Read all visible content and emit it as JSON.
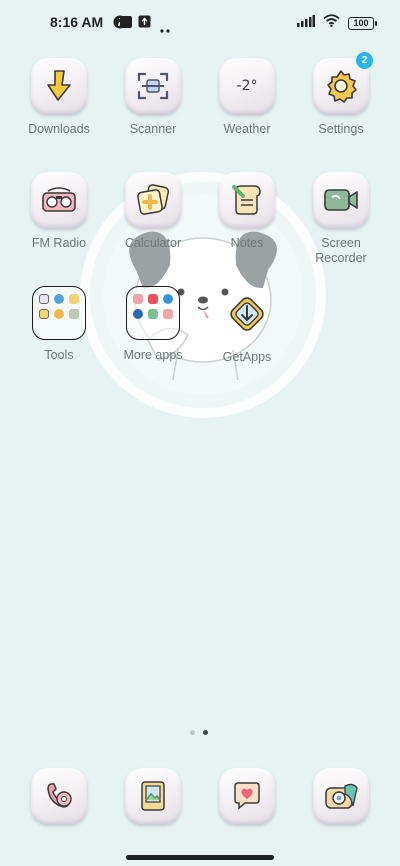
{
  "status_bar": {
    "time": "8:16 AM",
    "battery": "100",
    "icons": [
      "pinterest-icon",
      "square-notification-icon",
      "upload-icon",
      "more-dots-icon",
      "signal-icon",
      "wifi-icon",
      "battery-icon"
    ]
  },
  "apps": [
    {
      "label": "Downloads",
      "icon": "download-arrow-icon"
    },
    {
      "label": "Scanner",
      "icon": "scanner-icon"
    },
    {
      "label": "Weather",
      "icon": "weather-icon",
      "text": "-2°"
    },
    {
      "label": "Settings",
      "icon": "gear-icon",
      "badge": "2"
    },
    {
      "label": "FM Radio",
      "icon": "radio-icon"
    },
    {
      "label": "Calculator",
      "icon": "calculator-icon"
    },
    {
      "label": "Notes",
      "icon": "notes-icon"
    },
    {
      "label": "Screen\nRecorder",
      "icon": "video-camera-icon"
    },
    {
      "label": "Tools",
      "icon": "folder-icon"
    },
    {
      "label": "More apps",
      "icon": "folder-icon"
    },
    {
      "label": "GetApps",
      "icon": "getapps-icon"
    }
  ],
  "dock": [
    {
      "icon": "phone-icon"
    },
    {
      "icon": "gallery-icon"
    },
    {
      "icon": "messages-heart-icon"
    },
    {
      "icon": "camera-icon"
    }
  ],
  "pager": {
    "pages": 2,
    "active": 2
  },
  "colors": {
    "background": "#e6f3f2",
    "badge": "#2cb5e8"
  }
}
